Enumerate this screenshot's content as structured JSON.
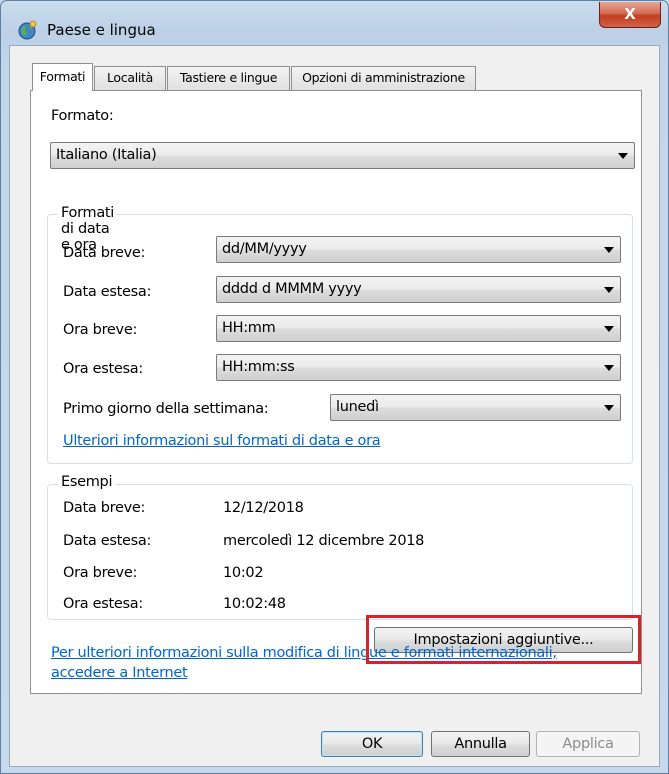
{
  "window": {
    "title": "Paese e lingua",
    "close_glyph": "X",
    "icon": "globe-icon"
  },
  "tabs": [
    {
      "label": "Formati",
      "active": true
    },
    {
      "label": "Località",
      "active": false
    },
    {
      "label": "Tastiere e lingue",
      "active": false
    },
    {
      "label": "Opzioni di amministrazione",
      "active": false
    }
  ],
  "format": {
    "label": "Formato:",
    "value": "Italiano (Italia)"
  },
  "datetime_group": {
    "title": "Formati di data e ora",
    "rows": [
      {
        "label": "Data breve:",
        "value": "dd/MM/yyyy"
      },
      {
        "label": "Data estesa:",
        "value": "dddd d MMMM yyyy"
      },
      {
        "label": "Ora breve:",
        "value": "HH:mm"
      },
      {
        "label": "Ora estesa:",
        "value": "HH:mm:ss"
      }
    ],
    "first_day": {
      "label": "Primo giorno della settimana:",
      "value": "lunedì"
    },
    "link": "Ulteriori informazioni sul formati di data e ora"
  },
  "examples_group": {
    "title": "Esempi",
    "rows": [
      {
        "label": "Data breve:",
        "value": "12/12/2018"
      },
      {
        "label": "Data estesa:",
        "value": "mercoledì 12 dicembre 2018"
      },
      {
        "label": "Ora breve:",
        "value": "10:02"
      },
      {
        "label": "Ora estesa:",
        "value": "10:02:48"
      }
    ]
  },
  "additional_settings_button": "Impostazioni aggiuntive...",
  "footer_link": {
    "line1": "Per ulteriori informazioni sulla modifica di lingue e formati internazionali,",
    "line2": "accedere a Internet"
  },
  "buttons": {
    "ok": "OK",
    "cancel": "Annulla",
    "apply": "Applica"
  },
  "colors": {
    "highlight": "#d9232a",
    "link": "#0066cc",
    "close_button": "#c23f20"
  }
}
